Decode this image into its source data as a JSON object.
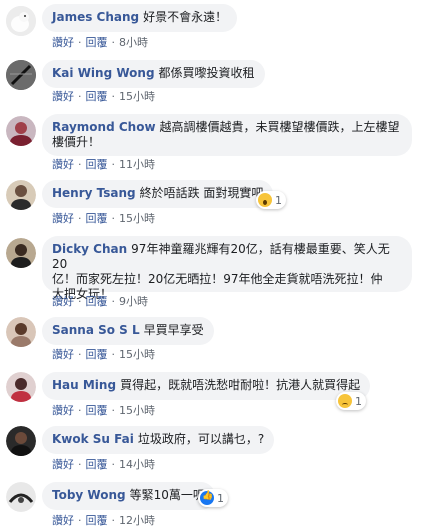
{
  "comments": [
    {
      "author": "James Chang",
      "text": "好景不會永遠！",
      "like": "讚好",
      "reply": "回覆",
      "time": "8小時"
    },
    {
      "author": "Kai Wing Wong",
      "text": "都係買嚟投資收租",
      "like": "讚好",
      "reply": "回覆",
      "time": "15小時"
    },
    {
      "author": "Raymond Chow",
      "text": "越高調樓價越貴，未買樓望樓價跌，上左樓望",
      "text2": "樓價升！",
      "like": "讚好",
      "reply": "回覆",
      "time": "11小時"
    },
    {
      "author": "Henry Tsang",
      "text": "終於唔話跌 面對現實吧",
      "like": "讚好",
      "reply": "回覆",
      "time": "15小時",
      "reaction_count": "1",
      "reaction": "wow"
    },
    {
      "author": "Dicky Chan",
      "text": "97年神童羅兆輝有20亿，話有樓最重要、笑人无20",
      "text2": "亿！而家死左拉！20亿无晒拉！97年他全走貨就唔洗死拉！仲",
      "text3": "大把女玩！",
      "like": "讚好",
      "reply": "回覆",
      "time": "9小時"
    },
    {
      "author": "Sanna So S L",
      "text": "早買早享受",
      "like": "讚好",
      "reply": "回覆",
      "time": "15小時"
    },
    {
      "author": "Hau Ming",
      "text": "買得起，既就唔洗愁咁耐啦！抗港人就買得起",
      "like": "讚好",
      "reply": "回覆",
      "time": "15小時",
      "reaction_count": "1",
      "reaction": "sad"
    },
    {
      "author": "Kwok Su Fai",
      "text": "垃圾政府，可以講乜，?",
      "like": "讚好",
      "reply": "回覆",
      "time": "14小時"
    },
    {
      "author": "Toby Wong",
      "text": "等緊10萬一呎",
      "like": "讚好",
      "reply": "回覆",
      "time": "12小時",
      "reaction_count": "1",
      "reaction": "like"
    }
  ]
}
